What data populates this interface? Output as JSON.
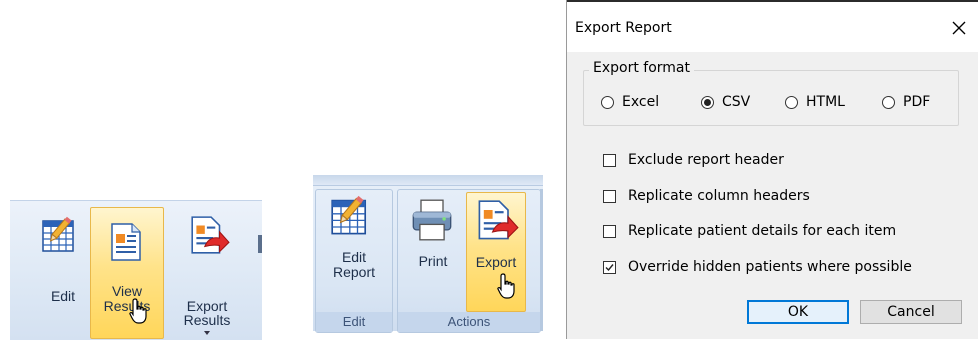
{
  "ribbon_small": {
    "edit_label": "Edit",
    "view_results_label": [
      "View",
      "Results"
    ],
    "export_results_label": [
      "Export",
      "Results"
    ],
    "icons": [
      "table-edit-icon",
      "document-report-icon",
      "export-results-icon",
      "mouse-cursor-icon"
    ]
  },
  "ribbon_groups": {
    "edit_report_label": [
      "Edit",
      "Report"
    ],
    "print_label": "Print",
    "export_label": "Export",
    "group_edit": "Edit",
    "group_actions": "Actions",
    "icons": [
      "table-edit-icon",
      "printer-icon",
      "export-icon",
      "mouse-cursor-icon"
    ]
  },
  "dialog": {
    "title": "Export Report",
    "format_legend": "Export format",
    "formats": [
      {
        "label": "Excel",
        "selected": false
      },
      {
        "label": "CSV",
        "selected": true
      },
      {
        "label": "HTML",
        "selected": false
      },
      {
        "label": "PDF",
        "selected": false
      }
    ],
    "options": [
      {
        "label": "Exclude report header",
        "checked": false
      },
      {
        "label": "Replicate column headers",
        "checked": false
      },
      {
        "label": "Replicate patient details for each item",
        "checked": false
      },
      {
        "label": "Override hidden patients where possible",
        "checked": true
      }
    ],
    "ok_label": "OK",
    "cancel_label": "Cancel",
    "colors": {
      "accent": "#0078d7",
      "face": "#f0f0f0"
    }
  }
}
